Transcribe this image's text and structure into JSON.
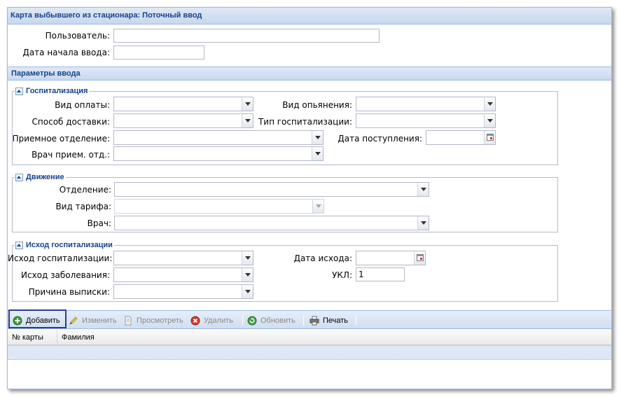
{
  "window": {
    "title": "Карта выбывшего из стационара: Поточный ввод"
  },
  "top": {
    "user_label": "Пользователь:",
    "user_value": "",
    "start_date_label": "Дата начала ввода:",
    "start_date_value": ""
  },
  "params": {
    "title": "Параметры ввода",
    "hospitalization": {
      "legend": "Госпитализация",
      "payment_type_label": "Вид оплаты:",
      "delivery_label": "Способ доставки:",
      "admission_dept_label": "Приемное отделение:",
      "admission_doctor_label": "Врач прием. отд.:",
      "intoxication_label": "Вид опьянения:",
      "hosp_type_label": "Тип госпитализации:",
      "arrival_date_label": "Дата поступления:"
    },
    "movement": {
      "legend": "Движение",
      "department_label": "Отделение:",
      "tariff_label": "Вид тарифа:",
      "doctor_label": "Врач:"
    },
    "outcome": {
      "legend": "Исход госпитализации",
      "hosp_outcome_label": "Исход госпитализации:",
      "disease_outcome_label": "Исход заболевания:",
      "discharge_reason_label": "Причина выписки:",
      "outcome_date_label": "Дата исхода:",
      "ukl_label": "УКЛ:",
      "ukl_value": "1"
    }
  },
  "toolbar": {
    "add": "Добавить",
    "edit": "Изменить",
    "view": "Просмотреть",
    "delete": "Удалить",
    "refresh": "Обновить",
    "print": "Печать"
  },
  "grid": {
    "columns": [
      "№ карты",
      "Фамилия"
    ]
  },
  "colors": {
    "header_text": "#15428b",
    "panel_border": "#99bbe8",
    "focus_border": "#2c3b96"
  }
}
